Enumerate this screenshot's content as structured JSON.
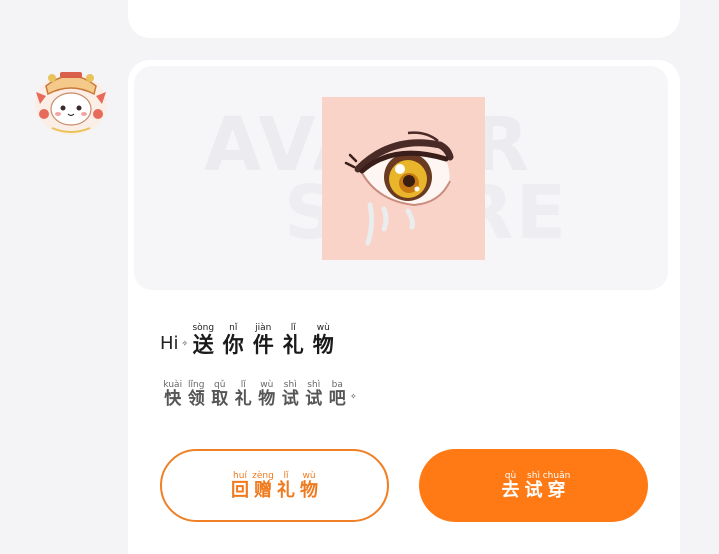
{
  "top_card": {},
  "banner": {
    "bg_word_1": "AVATAR",
    "bg_word_2": "STORE",
    "item_image": "anime-eye-item"
  },
  "gift_title": {
    "greeting": "Hi",
    "chars": [
      {
        "hz": "送",
        "py": "sòng"
      },
      {
        "hz": "你",
        "py": "nǐ"
      },
      {
        "hz": "件",
        "py": "jiàn"
      },
      {
        "hz": "礼",
        "py": "lǐ"
      },
      {
        "hz": "物",
        "py": "wù"
      }
    ]
  },
  "gift_subtitle": {
    "chars": [
      {
        "hz": "快",
        "py": "kuài"
      },
      {
        "hz": "领",
        "py": "lǐng"
      },
      {
        "hz": "取",
        "py": "qǔ"
      },
      {
        "hz": "礼",
        "py": "lǐ"
      },
      {
        "hz": "物",
        "py": "wù"
      },
      {
        "hz": "试",
        "py": "shì"
      },
      {
        "hz": "试",
        "py": "shì"
      },
      {
        "hz": "吧",
        "py": "ba"
      }
    ]
  },
  "buttons": {
    "return_gift": [
      {
        "hz": "回",
        "py": "huí"
      },
      {
        "hz": "赠",
        "py": "zèng"
      },
      {
        "hz": "礼",
        "py": "lǐ"
      },
      {
        "hz": "物",
        "py": "wù"
      }
    ],
    "try_on": [
      {
        "hz": "去",
        "py": "qù"
      },
      {
        "hz": "试",
        "py": "shì"
      },
      {
        "hz": "穿",
        "py": "chuān"
      }
    ]
  },
  "colors": {
    "accent": "#ff7a14",
    "outline": "#f08026",
    "page_bg": "#f4f4f6"
  },
  "icons": {
    "avatar": "cat-mascot-avatar",
    "sparkle": "sparkle-icon"
  }
}
